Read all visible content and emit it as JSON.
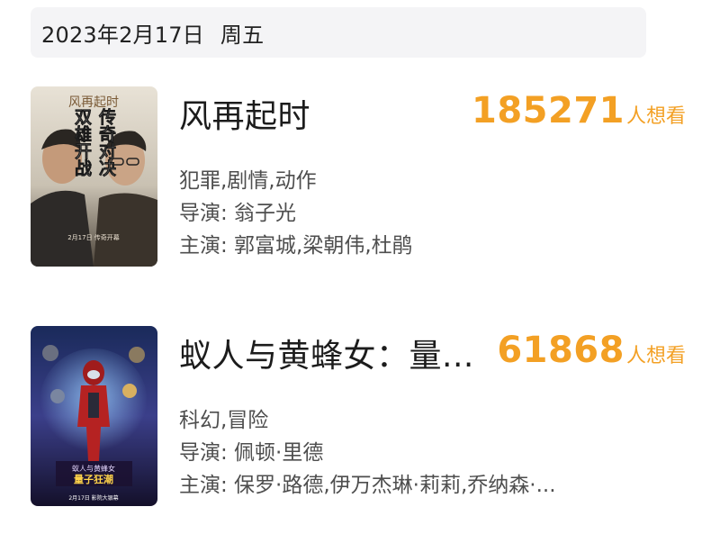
{
  "date_bar": {
    "date": "2023年2月17日",
    "weekday": "周五"
  },
  "movies": [
    {
      "title": "风再起时",
      "want_count": "185271",
      "want_label": "人想看",
      "genre": "犯罪,剧情,动作",
      "director": "导演: 翁子光",
      "cast": "主演: 郭富城,梁朝伟,杜鹃",
      "poster": {
        "logo_text": "风再起时",
        "tagline_left": "双雄开战",
        "tagline_right": "传奇对决",
        "release": "2月17日 传奇开幕"
      }
    },
    {
      "title": "蚁人与黄蜂女：量...",
      "want_count": "61868",
      "want_label": "人想看",
      "genre": "科幻,冒险",
      "director": "导演: 佩顿·里德",
      "cast": "主演: 保罗·路德,伊万杰琳·莉莉,乔纳森·...",
      "poster": {
        "logo_text": "蚁人与黄蜂女",
        "subtitle": "量子狂潮",
        "release": "2月17日 影院大银幕"
      }
    }
  ],
  "colors": {
    "accent": "#f3a024",
    "date_bar_bg": "#f4f4f6"
  }
}
